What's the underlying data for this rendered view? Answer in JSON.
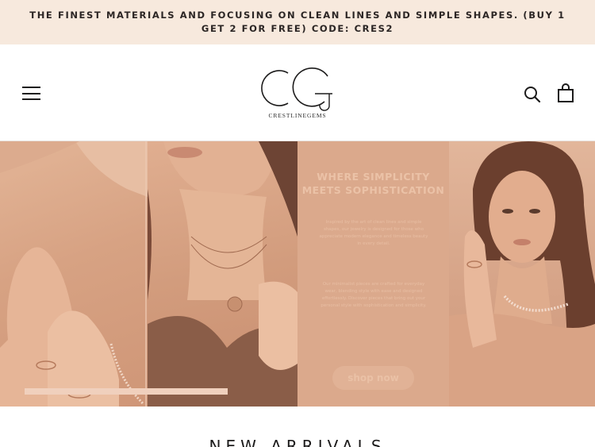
{
  "announcement": {
    "text": "The finest materials and focusing on clean lines and simple shapes. (Buy 1 get 2 for free) Code: CRES2"
  },
  "header": {
    "menu_icon": "hamburger-menu-icon",
    "logo_text": "CRESTLINEGEMS",
    "search_icon": "search-icon",
    "cart_icon": "shopping-bag-icon"
  },
  "hero": {
    "title": "Where simplicity meets sophistication",
    "body_1": "Inspired by the art of clean lines and simple shapes, our jewelry is designed for those who appreciate modern elegance and timeless beauty in every detail.",
    "body_2": "Our minimalist pieces are crafted for everyday wear, blending style with ease and designed effortlessly. Discover pieces that bring out your personal style with sophistication and simplicity.",
    "button_label": "shop now"
  },
  "section": {
    "title": "New Arrivals"
  },
  "colors": {
    "announcement_bg": "#f7e9dd",
    "hero_tone": "#d9a88c",
    "text": "#1c1b1b"
  }
}
